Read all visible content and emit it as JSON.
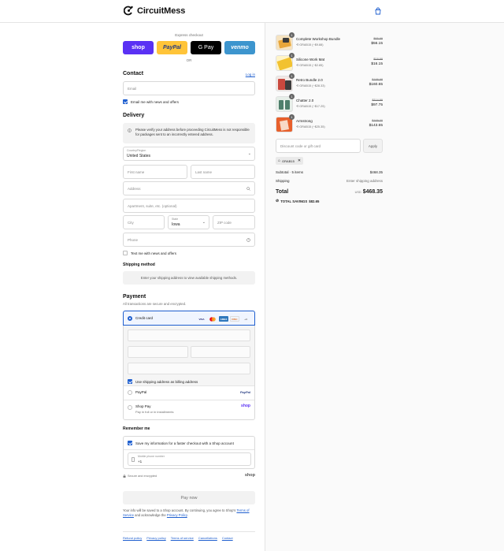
{
  "brand": {
    "name": "CircuitMess",
    "accent": "#1f5fcf"
  },
  "express": {
    "label": "Express checkout",
    "buttons": [
      "shop",
      "PayPal",
      "G Pay",
      "venmo"
    ],
    "or": "OR"
  },
  "contact": {
    "title": "Contact",
    "login": "Log in",
    "email_placeholder": "Email",
    "email_news": "Email me with news and offers"
  },
  "delivery": {
    "title": "Delivery",
    "notice": "Please verify your address before proceeding CircuitMess is not responsible for packages sent to an incorrectly entered address.",
    "country_label": "Country/Region",
    "country_value": "United States",
    "first_name": "First name",
    "last_name": "Last name",
    "address": "Address",
    "apartment": "Apartment, suite, etc. (optional)",
    "city": "City",
    "state_label": "State",
    "state_value": "Iowa",
    "zip": "ZIP code",
    "phone": "Phone",
    "text_news": "Text me with news and offers"
  },
  "shipping": {
    "title": "Shipping method",
    "notice": "Enter your shipping address to view available shipping methods."
  },
  "payment": {
    "title": "Payment",
    "subtitle": "All transactions are secure and encrypted.",
    "credit_card": "Credit card",
    "brands": [
      "VISA",
      "MC",
      "AMEX",
      "DISC",
      "+4"
    ],
    "billing_same": "Use shipping address as billing address",
    "paypal": "PayPal",
    "shop_pay": "Shop Pay",
    "shop_pay_sub": "Pay in full or in installments"
  },
  "remember": {
    "title": "Remember me",
    "save_info": "Save my information for a faster checkout with a Shop account",
    "mobile_label": "Mobile phone number",
    "mobile_value": "+1",
    "secure": "Secure and encrypted",
    "shop_logo": "shop"
  },
  "pay_now": "Pay now",
  "legal": {
    "text_before": "Your info will be saved to a Shop account. By continuing, you agree to Shop's",
    "terms": "Terms of Service",
    "text_mid": "and acknowledge the",
    "privacy": "Privacy Policy",
    "text_end": "."
  },
  "footer_links": [
    "Refund policy",
    "Privacy policy",
    "Terms of service",
    "Cancellations",
    "Contact"
  ],
  "cart": {
    "items": [
      {
        "name": "Complete Workshop Bundle",
        "qty": "1",
        "discount": "GRAB15 (−$9.88)",
        "old": "$65.99",
        "new": "$56.15",
        "color": "#e8a63a"
      },
      {
        "name": "Silicone Work Mat",
        "qty": "1",
        "discount": "GRAB15 (−$2.85)",
        "old": "$18.99",
        "new": "$16.15",
        "color": "#f2c230"
      },
      {
        "name": "Retro Bundle 2.0",
        "qty": "1",
        "discount": "GRAB15 (−$28.33)",
        "old": "$188.98",
        "new": "$160.65",
        "color": "#c9483e"
      },
      {
        "name": "Chatter 2.0",
        "qty": "1",
        "discount": "GRAB15 (−$17.25)",
        "old": "$114.99",
        "new": "$97.75",
        "color": "#4f7f6c"
      },
      {
        "name": "Armstrong",
        "qty": "1",
        "discount": "GRAB15 (−$25.35)",
        "old": "$169.00",
        "new": "$143.65",
        "color": "#e8602c"
      }
    ],
    "discount_placeholder": "Discount code or gift card",
    "apply": "Apply",
    "code": "GRAB15",
    "subtotal_label": "Subtotal · 5 items",
    "subtotal": "$468.35",
    "shipping_label": "Shipping",
    "shipping_value": "Enter shipping address",
    "total_label": "Total",
    "currency": "USD",
    "total": "$468.35",
    "savings_label": "TOTAL SAVINGS",
    "savings": "$82.65"
  }
}
